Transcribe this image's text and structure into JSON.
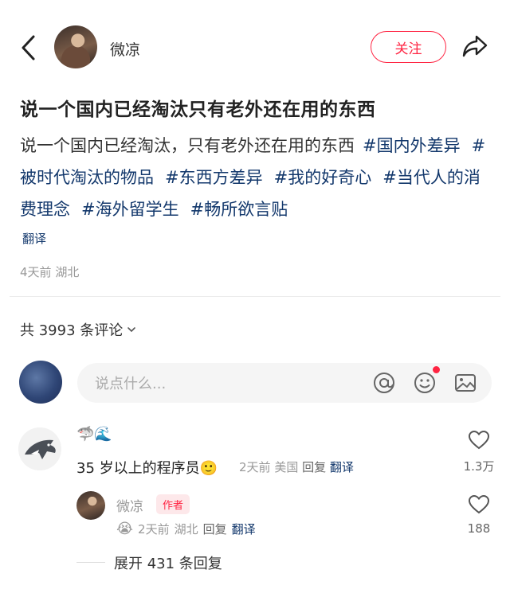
{
  "header": {
    "author_name": "微凉",
    "follow_label": "关注"
  },
  "post": {
    "title": "说一个国内已经淘汰只有老外还在用的东西",
    "body_text": "说一个国内已经淘汰，只有老外还在用的东西",
    "tags": [
      "#国内外差异",
      "#被时代淘汰的物品",
      "#东西方差异",
      "#我的好奇心",
      "#当代人的消费理念",
      "#海外留学生",
      "#畅所欲言贴"
    ],
    "translate_label": "翻译",
    "time": "4天前",
    "location": "湖北"
  },
  "comments_header": {
    "count_label": "共 3993 条评论"
  },
  "input": {
    "placeholder": "说点什么..."
  },
  "comments": [
    {
      "name_emoji": "🦈🌊",
      "text": "35 岁以上的程序员",
      "text_emoji": "🙂",
      "time": "2天前",
      "location": "美国",
      "reply_label": "回复",
      "translate_label": "翻译",
      "likes": "1.3万",
      "reply": {
        "name": "微凉",
        "badge": "作者",
        "emoji": "😭",
        "time": "2天前",
        "location": "湖北",
        "reply_label": "回复",
        "translate_label": "翻译",
        "likes": "188"
      },
      "expand_label": "展开 431 条回复"
    }
  ],
  "colors": {
    "brand_red": "#ff2442",
    "tag_blue": "#13386c",
    "meta_gray": "#999999"
  },
  "icons": [
    "back-icon",
    "share-icon",
    "chevron-down-icon",
    "at-icon",
    "emoji-icon",
    "image-icon",
    "heart-icon"
  ]
}
